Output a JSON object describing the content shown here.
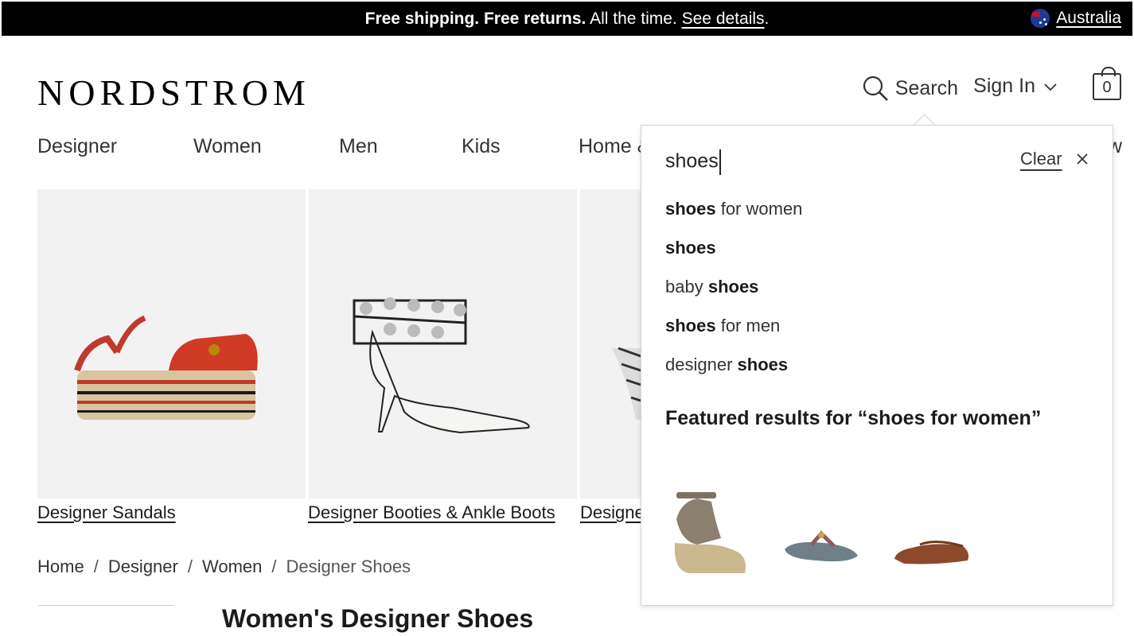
{
  "promo": {
    "bold1": "Free shipping.",
    "bold2": "Free returns.",
    "text": "All the time.",
    "link": "See details",
    "period": ".",
    "country": "Australia"
  },
  "header": {
    "logo": "NORDSTROM",
    "search_label": "Search",
    "signin_label": "Sign In",
    "bag_count": "0"
  },
  "nav": {
    "items": [
      "Designer",
      "Women",
      "Men",
      "Kids",
      "Home &"
    ],
    "partial_right": "w"
  },
  "tiles": [
    {
      "label": "Designer Sandals"
    },
    {
      "label": "Designer Booties & Ankle Boots"
    },
    {
      "label": "Designer"
    }
  ],
  "breadcrumb": {
    "items": [
      "Home",
      "Designer",
      "Women",
      "Designer Shoes"
    ],
    "separator": "/"
  },
  "page_title": "Women's Designer Shoes",
  "search_dropdown": {
    "query": "shoes",
    "clear_label": "Clear",
    "suggestions": [
      {
        "pre": "",
        "bold": "shoes",
        "post": " for women"
      },
      {
        "pre": "",
        "bold": "shoes",
        "post": ""
      },
      {
        "pre": "baby ",
        "bold": "shoes",
        "post": ""
      },
      {
        "pre": "",
        "bold": "shoes",
        "post": " for men"
      },
      {
        "pre": "designer ",
        "bold": "shoes",
        "post": ""
      }
    ],
    "featured_heading": "Featured results for “shoes for women”"
  },
  "colors": {
    "promo_bg": "#000000",
    "tile_bg": "#f2f2f2",
    "text": "#1b1b1b"
  }
}
